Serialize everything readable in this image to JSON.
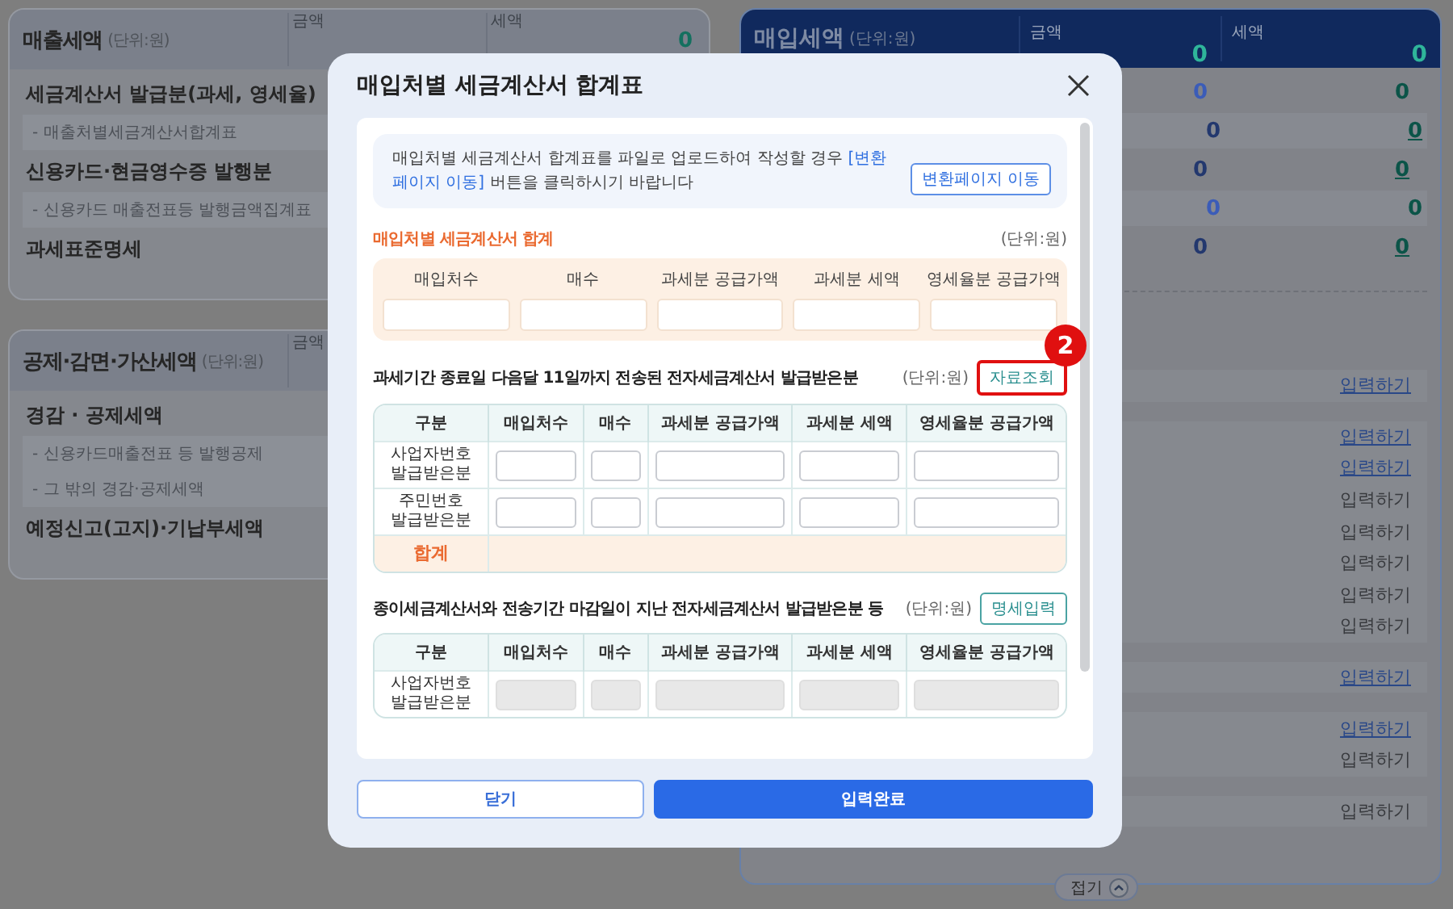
{
  "background": {
    "left_panels": [
      {
        "title": "매출세액",
        "unit": "(단위:원)",
        "columns": [
          {
            "label": "금액"
          },
          {
            "label": "세액",
            "value": "0"
          }
        ],
        "rows": [
          {
            "label": "세금계산서 발급분(과세, 영세율)",
            "kind": "main"
          },
          {
            "label": "- 매출처별세금계산서합계표",
            "kind": "sub"
          },
          {
            "label": "신용카드·현금영수증 발행분",
            "kind": "main"
          },
          {
            "label": "- 신용카드 매출전표등 발행금액집계표",
            "kind": "sub"
          },
          {
            "label": "과세표준명세",
            "kind": "main"
          }
        ]
      },
      {
        "title": "공제·감면·가산세액",
        "unit": "(단위:원)",
        "columns": [
          {
            "label": "금액"
          }
        ],
        "rows": [
          {
            "label": "경감 · 공제세액",
            "kind": "main"
          },
          {
            "label": "- 신용카드매출전표 등 발행공제",
            "kind": "sub"
          },
          {
            "label": "- 그 밖의 경감·공제세액",
            "kind": "sub"
          },
          {
            "label": "예정신고(고지)·기납부세액",
            "kind": "main"
          }
        ]
      }
    ],
    "right_panel": {
      "title": "매입세액",
      "unit": "(단위:원)",
      "columns": [
        {
          "label": "금액",
          "value": "0"
        },
        {
          "label": "세액",
          "value": "0"
        }
      ],
      "value_rows": [
        {
          "amount": "0",
          "tax": "0",
          "linked": false
        },
        {
          "amount": "0",
          "tax": "0",
          "linked": true
        },
        {
          "amount": "0",
          "tax": "0",
          "linked": true
        },
        {
          "amount": "0",
          "tax": "0",
          "linked": false
        },
        {
          "amount": "0",
          "tax": "0",
          "linked": true
        }
      ],
      "link_groups": [
        [
          {
            "label": "입력하기",
            "active": true
          }
        ],
        [
          {
            "label": "입력하기",
            "active": true
          },
          {
            "label": "입력하기",
            "active": true
          },
          {
            "label": "입력하기",
            "active": false
          },
          {
            "label": "입력하기",
            "active": false
          },
          {
            "label": "입력하기",
            "active": false
          },
          {
            "label": "입력하기",
            "active": false
          },
          {
            "label": "입력하기",
            "active": false
          }
        ],
        [
          {
            "label": "입력하기",
            "active": true
          }
        ],
        [
          {
            "label": "입력하기",
            "active": true
          },
          {
            "label": "입력하기",
            "active": false
          }
        ],
        [
          {
            "label": "입력하기",
            "active": false
          }
        ]
      ],
      "collapse_button": "접기"
    }
  },
  "modal": {
    "title": "매입처별 세금계산서 합계표",
    "notice": {
      "before": "매입처별 세금계산서 합계표를 파일로 업로드하여 작성할 경우 ",
      "highlight": "[변환페이지 이동]",
      "after": " 버튼을 클릭하시기 바랍니다",
      "button": "변환페이지 이동"
    },
    "summary": {
      "title": "매입처별 세금계산서 합계",
      "unit": "(단위:원)",
      "columns": [
        "매입처수",
        "매수",
        "과세분 공급가액",
        "과세분 세액",
        "영세율분 공급가액"
      ]
    },
    "sections": [
      {
        "title": "과세기간 종료일 다음달 11일까지 전송된 전자세금계산서 발급받은분",
        "unit": "(단위:원)",
        "button": "자료조회",
        "highlighted": true,
        "badge": "2",
        "columns": [
          "구분",
          "매입처수",
          "매수",
          "과세분 공급가액",
          "과세분 세액",
          "영세율분 공급가액"
        ],
        "rows": [
          {
            "label": "사업자번호\n발급받은분",
            "disabled": false
          },
          {
            "label": "주민번호\n발급받은분",
            "disabled": false
          }
        ],
        "total_label": "합계"
      },
      {
        "title": "종이세금계산서와 전송기간 마감일이 지난 전자세금계산서 발급받은분 등",
        "unit": "(단위:원)",
        "button": "명세입력",
        "highlighted": false,
        "columns": [
          "구분",
          "매입처수",
          "매수",
          "과세분 공급가액",
          "과세분 세액",
          "영세율분 공급가액"
        ],
        "rows": [
          {
            "label": "사업자번호\n발급받은분",
            "disabled": true
          }
        ]
      }
    ],
    "buttons": [
      {
        "label": "닫기",
        "kind": "secondary"
      },
      {
        "label": "입력완료",
        "kind": "primary"
      }
    ]
  }
}
